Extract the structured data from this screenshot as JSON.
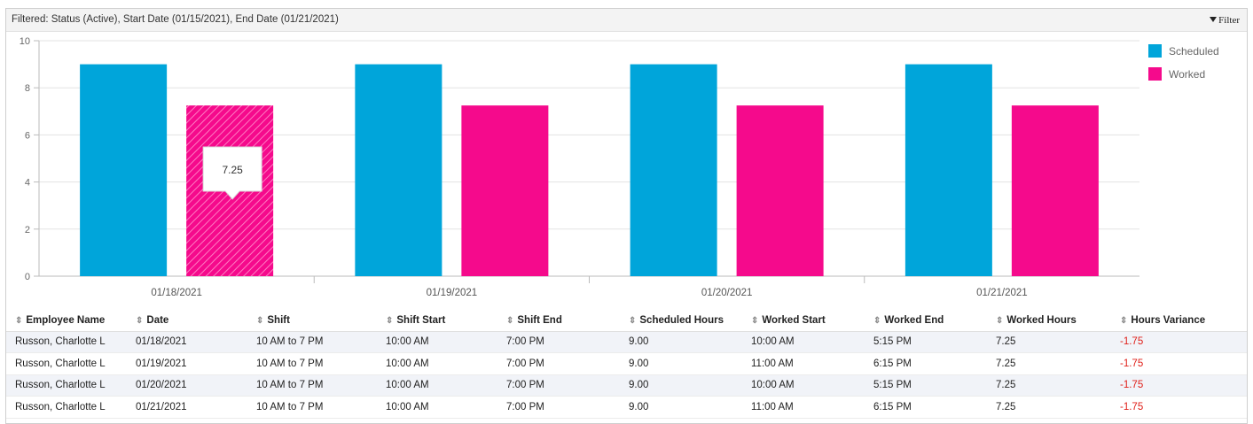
{
  "filter_bar": {
    "text": "Filtered: Status (Active), Start Date (01/15/2021), End Date (01/21/2021)",
    "filter_label": "Filter"
  },
  "chart_data": {
    "type": "bar",
    "categories": [
      "01/18/2021",
      "01/19/2021",
      "01/20/2021",
      "01/21/2021"
    ],
    "series": [
      {
        "name": "Scheduled",
        "color": "#00a5da",
        "values": [
          9,
          9,
          9,
          9
        ]
      },
      {
        "name": "Worked",
        "color": "#f50a8c",
        "values": [
          7.25,
          7.25,
          7.25,
          7.25
        ]
      }
    ],
    "ylim": [
      0,
      10
    ],
    "yticks": [
      0,
      2,
      4,
      6,
      8,
      10
    ],
    "grid": true,
    "legend_position": "top-right",
    "tooltip": {
      "series": "Worked",
      "category": "01/18/2021",
      "text": "7.25"
    }
  },
  "table": {
    "columns": [
      "Employee Name",
      "Date",
      "Shift",
      "Shift Start",
      "Shift End",
      "Scheduled Hours",
      "Worked Start",
      "Worked End",
      "Worked Hours",
      "Hours Variance"
    ],
    "rows": [
      [
        "Russon, Charlotte L",
        "01/18/2021",
        "10 AM to 7 PM",
        "10:00 AM",
        "7:00 PM",
        "9.00",
        "10:00 AM",
        "5:15 PM",
        "7.25",
        "-1.75"
      ],
      [
        "Russon, Charlotte L",
        "01/19/2021",
        "10 AM to 7 PM",
        "10:00 AM",
        "7:00 PM",
        "9.00",
        "11:00 AM",
        "6:15 PM",
        "7.25",
        "-1.75"
      ],
      [
        "Russon, Charlotte L",
        "01/20/2021",
        "10 AM to 7 PM",
        "10:00 AM",
        "7:00 PM",
        "9.00",
        "10:00 AM",
        "5:15 PM",
        "7.25",
        "-1.75"
      ],
      [
        "Russon, Charlotte L",
        "01/21/2021",
        "10 AM to 7 PM",
        "10:00 AM",
        "7:00 PM",
        "9.00",
        "11:00 AM",
        "6:15 PM",
        "7.25",
        "-1.75"
      ]
    ],
    "negative_color": "#e0201a",
    "sort_icon": "sort-icon"
  }
}
